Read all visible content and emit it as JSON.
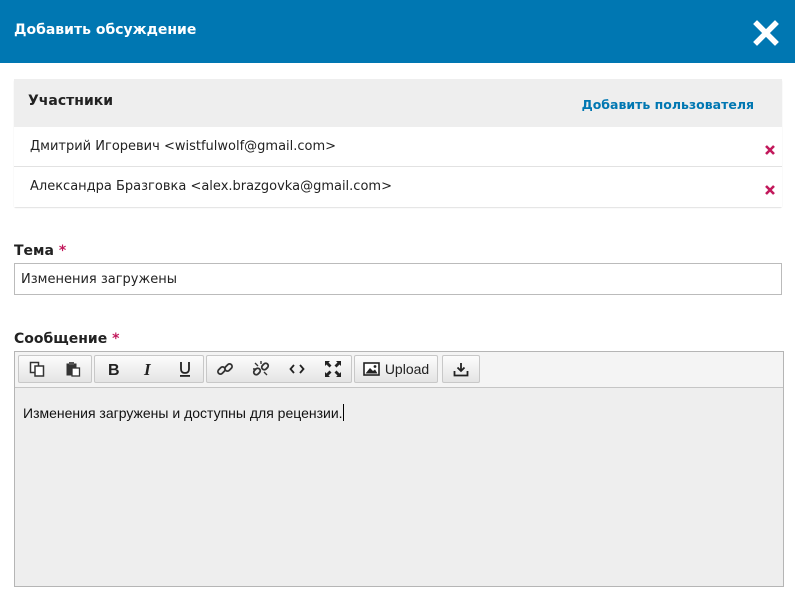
{
  "dialog": {
    "title": "Добавить обсуждение"
  },
  "participants": {
    "heading": "Участники",
    "add_user_label": "Добавить пользователя",
    "items": [
      {
        "name": "Дмитрий Игоревич <wistfulwolf@gmail.com>"
      },
      {
        "name": "Александра Бразговка <alex.brazgovka@gmail.com>"
      }
    ]
  },
  "subject": {
    "label": "Тема",
    "required_mark": "*",
    "value": "Изменения загружены"
  },
  "message": {
    "label": "Сообщение",
    "required_mark": "*",
    "toolbar": {
      "upload_label": "Upload",
      "icons": [
        "copy-icon",
        "paste-icon",
        "bold-icon",
        "italic-icon",
        "underline-icon",
        "link-icon",
        "unlink-icon",
        "code-icon",
        "fullscreen-icon",
        "image-icon",
        "download-icon"
      ]
    },
    "body": "Изменения загружены и доступны для рецензии."
  },
  "colors": {
    "header_bg": "#0077b2",
    "link": "#0077b2",
    "required": "#c2185b",
    "remove_icon": "#c2185b"
  }
}
